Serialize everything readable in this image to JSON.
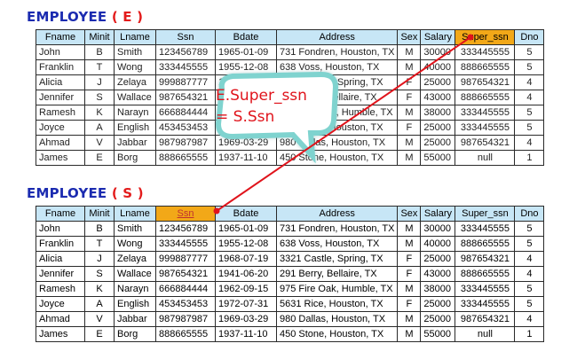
{
  "top": {
    "title_main": "EMPLOYEE",
    "title_alias": "( E )"
  },
  "bottom": {
    "title_main": "EMPLOYEE",
    "title_alias": "( S )"
  },
  "callout": {
    "line1": "E.Super_ssn",
    "line2": "= S.Ssn"
  },
  "headers": [
    "Fname",
    "Minit",
    "Lname",
    "Ssn",
    "Bdate",
    "Address",
    "Sex",
    "Salary",
    "Super_ssn",
    "Dno"
  ],
  "rows": [
    [
      "John",
      "B",
      "Smith",
      "123456789",
      "1965-01-09",
      "731 Fondren, Houston, TX",
      "M",
      "30000",
      "333445555",
      "5"
    ],
    [
      "Franklin",
      "T",
      "Wong",
      "333445555",
      "1955-12-08",
      "638 Voss, Houston, TX",
      "M",
      "40000",
      "888665555",
      "5"
    ],
    [
      "Alicia",
      "J",
      "Zelaya",
      "999887777",
      "1968-07-19",
      "3321 Castle, Spring, TX",
      "F",
      "25000",
      "987654321",
      "4"
    ],
    [
      "Jennifer",
      "S",
      "Wallace",
      "987654321",
      "1941-06-20",
      "291 Berry, Bellaire, TX",
      "F",
      "43000",
      "888665555",
      "4"
    ],
    [
      "Ramesh",
      "K",
      "Narayn",
      "666884444",
      "1962-09-15",
      "975 Fire Oak, Humble, TX",
      "M",
      "38000",
      "333445555",
      "5"
    ],
    [
      "Joyce",
      "A",
      "English",
      "453453453",
      "1972-07-31",
      "5631 Rice, Houston, TX",
      "F",
      "25000",
      "333445555",
      "5"
    ],
    [
      "Ahmad",
      "V",
      "Jabbar",
      "987987987",
      "1969-03-29",
      "980 Dallas, Houston, TX",
      "M",
      "25000",
      "987654321",
      "4"
    ],
    [
      "James",
      "E",
      "Borg",
      "888665555",
      "1937-11-10",
      "450 Stone, Houston, TX",
      "M",
      "55000",
      "null",
      "1"
    ]
  ],
  "colors": {
    "header_bg": "#c7e6f6",
    "highlight_bg": "#f2a818",
    "title_color": "#1b2bb0",
    "alias_color": "#e31b1b",
    "arrow_color": "#e0141c"
  }
}
